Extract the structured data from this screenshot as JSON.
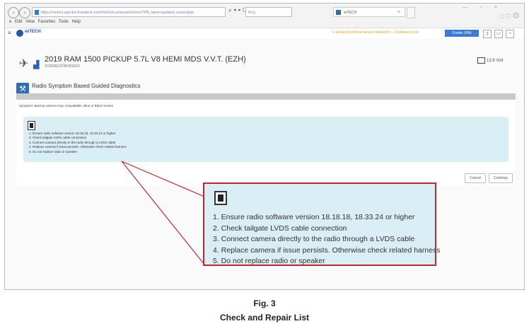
{
  "browser": {
    "url": "https://content.app.dev.fcawitech.com/#/vehicle-preparation/rsm/TPB_name=updated_issues/ipds",
    "search_placeholder": "Bing",
    "tab_title": "wiTECH",
    "menu": [
      "e",
      "Edit",
      "View",
      "Favorites",
      "Tools",
      "Help"
    ]
  },
  "app": {
    "logo_text": "wiTECH",
    "warning_text": "⚠ Unsaved vehicle session detected — Continue to run",
    "create_button": "Create JIRA"
  },
  "vehicle": {
    "title": "2019 RAM 1500 PICKUP 5.7L V8 HEMI MDS V.V.T. (EZH)",
    "vin": "1C6RREST4KN53062",
    "right_label": "13.8 Volt"
  },
  "panel": {
    "title": "Radio Symptom Based Guided Diagnostics",
    "symptom": "Symptom: Backup camera mop, Unavailable, Blue or Black Screen"
  },
  "steps": [
    "1. Ensure radio software version 18.18.18, 18.33.24 or higher",
    "2. Check tailgate LVDS cable connection",
    "3. Connect camera directly to the radio through a LVDS cable",
    "4. Replace camera if issue persists. Otherwise check related harness",
    "5. Do not replace radio or speaker"
  ],
  "zoom_steps": [
    "1. Ensure radio software version 18.18.18, 18.33.24 or higher",
    "2. Check tailgate LVDS cable connection",
    "3. Connect camera directly to the radio through a LVDS cable",
    "4. Replace camera if issue persists. Otherwise check related harness",
    "5. Do not replace radio or speaker"
  ],
  "buttons": {
    "cancel": "Cancel",
    "continue": "Continue"
  },
  "caption": {
    "fig": "Fig. 3",
    "title": "Check and Repair List"
  },
  "colors": {
    "panel_bg": "#d9eef5",
    "callout_border": "#c0282e",
    "brand_blue": "#2c6fb8"
  }
}
